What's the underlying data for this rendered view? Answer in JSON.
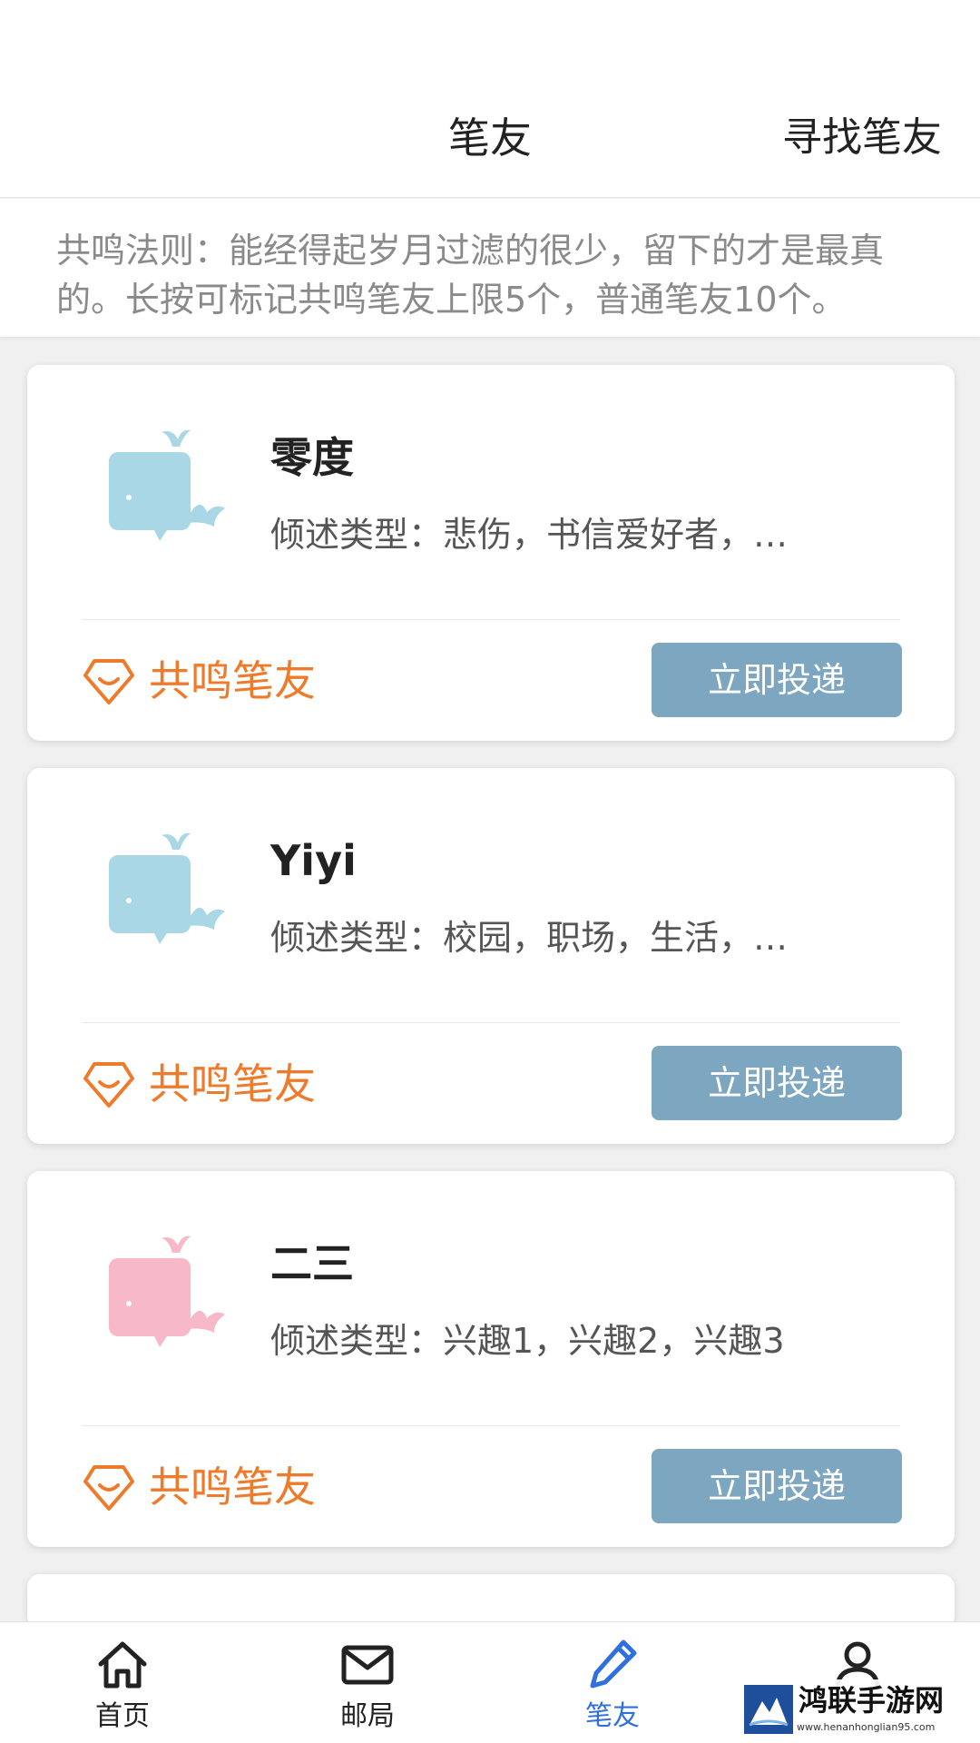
{
  "header": {
    "title": "笔友",
    "find_button": "寻找笔友"
  },
  "notice": {
    "text": "共鸣法则：能经得起岁月过滤的很少，留下的才是最真的。长按可标记共鸣笔友上限5个，普通笔友10个。"
  },
  "penpals": [
    {
      "name": "零度",
      "types": "倾述类型：悲伤，书信爱好者，…",
      "avatar_icon": "whale-icon",
      "avatar_color": "#a9d7e6",
      "resonate_label": "共鸣笔友",
      "send_label": "立即投递"
    },
    {
      "name": "Yiyi",
      "types": "倾述类型：校园，职场，生活，…",
      "avatar_icon": "whale-icon",
      "avatar_color": "#a9d7e6",
      "resonate_label": "共鸣笔友",
      "send_label": "立即投递"
    },
    {
      "name": "二三",
      "types": "倾述类型：兴趣1，兴趣2，兴趣3",
      "avatar_icon": "whale-icon",
      "avatar_color": "#f7b8c8",
      "resonate_label": "共鸣笔友",
      "send_label": "立即投递"
    }
  ],
  "colors": {
    "accent_orange": "#ee7a2b",
    "button_blue": "#7da6c1",
    "active_tab": "#2f6fe0"
  },
  "tabbar": {
    "items": [
      {
        "label": "首页",
        "icon": "home-icon",
        "active": false
      },
      {
        "label": "邮局",
        "icon": "mail-icon",
        "active": false
      },
      {
        "label": "笔友",
        "icon": "pen-icon",
        "active": true
      },
      {
        "label": "",
        "icon": "user-icon",
        "active": false
      }
    ]
  },
  "watermark": {
    "title": "鸿联手游网",
    "url": "www.henanhonglian95.com"
  }
}
